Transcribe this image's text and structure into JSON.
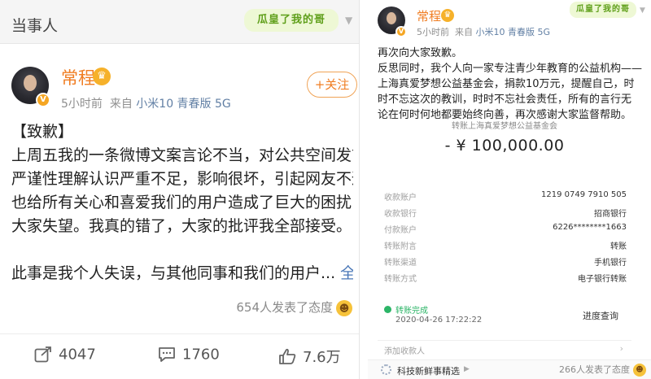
{
  "left": {
    "header_title": "当事人",
    "sticker_text": "瓜皇了我的哥",
    "user": {
      "name": "常程",
      "time": "5小时前",
      "source_prefix": "来自",
      "source": "小米10 青春版 5G"
    },
    "follow_label": "+关注",
    "body_lines": [
      "【致歉】",
      "上周五我的一条微博文案言论不当，对公共空间发言的",
      "严谨性理解认识严重不足，影响很坏，引起网友不适，",
      "也给所有关心和喜爱我们的用户造成了巨大的困扰，让",
      "大家失望。我真的错了，大家的批评我全部接受。"
    ],
    "truncated_line": "此事是我个人失误，与其他同事和我们的用户...",
    "full_text_link": "全文",
    "reactions_text": "654人发表了态度",
    "actions": {
      "repost_count": "4047",
      "comment_count": "1760",
      "like_count": "7.6万"
    }
  },
  "right": {
    "sticker_text": "瓜皇了我的哥",
    "user": {
      "name": "常程",
      "time": "5小时前",
      "source_prefix": "来自",
      "source": "小米10 青春版 5G"
    },
    "body_lines": [
      "再次向大家致歉。",
      "反思同时，我个人向一家专注青少年教育的公益机构——",
      "上海真爱梦想公益基金会，捐款10万元，提醒自己，时",
      "时不忘这次的教训，时时不忘社会责任，所有的言行无",
      "论在何时何地都要始终向善，再次感谢大家监督帮助。"
    ],
    "receipt": {
      "title": "转账上海真爱梦想公益基金会",
      "amount": "- ¥ 100,000.00",
      "rows": [
        {
          "key": "收款账户",
          "value": "1219 0749 7910 505"
        },
        {
          "key": "收款银行",
          "value": "招商银行"
        },
        {
          "key": "付款账户",
          "value": "6226********1663"
        },
        {
          "key": "转账附言",
          "value": "转账"
        },
        {
          "key": "转账渠道",
          "value": "手机银行"
        },
        {
          "key": "转账方式",
          "value": "电子银行转账"
        }
      ],
      "status": "转账完成",
      "status_date": "2020-04-26 17:22:22",
      "progress_label": "进度查询",
      "add_payee": "添加收款人"
    },
    "footer": {
      "tech_label": "科技新鲜事精选",
      "reactions_text": "266人发表了态度"
    }
  },
  "colors": {
    "name_orange": "#f07d22",
    "link_blue": "#4b78b8",
    "status_green": "#2cb567",
    "vip_gold": "#f6b12a"
  },
  "icons": [
    "crown-icon",
    "verified-badge-icon",
    "chevron-down-icon",
    "smiley-icon",
    "repost-icon",
    "comment-icon",
    "like-icon",
    "chevron-right-icon",
    "topic-icon"
  ]
}
